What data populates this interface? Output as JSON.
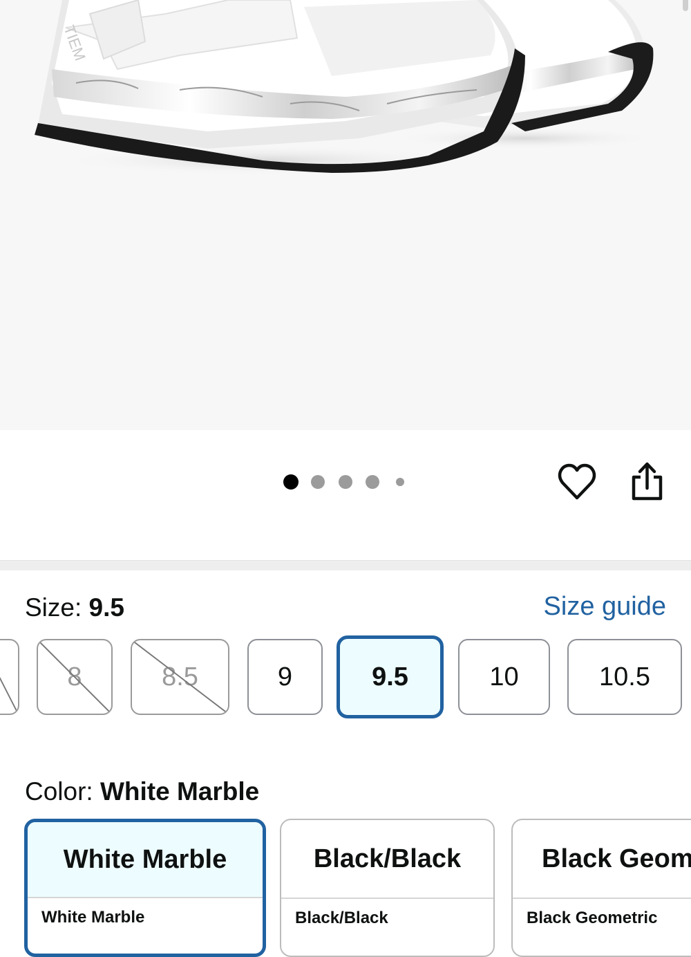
{
  "product_image": {
    "alt": "White marble cycling shoes",
    "brand_mark": "TIEM"
  },
  "carousel": {
    "total": 5,
    "active_index": 0
  },
  "actions": {
    "favorite_icon": "heart-icon",
    "share_icon": "share-icon"
  },
  "size": {
    "label": "Size:",
    "selected": "9.5",
    "guide_link": "Size guide",
    "options": [
      {
        "label": "",
        "available": false
      },
      {
        "label": "8",
        "available": false
      },
      {
        "label": "8.5",
        "available": false
      },
      {
        "label": "9",
        "available": true
      },
      {
        "label": "9.5",
        "available": true
      },
      {
        "label": "10",
        "available": true
      },
      {
        "label": "10.5",
        "available": true
      }
    ]
  },
  "color": {
    "label": "Color:",
    "selected": "White Marble",
    "options": [
      {
        "title": "White Marble",
        "subtitle": "White Marble"
      },
      {
        "title": "Black/Black",
        "subtitle": "Black/Black"
      },
      {
        "title": "Black Geom",
        "subtitle": "Black Geometric"
      }
    ]
  },
  "colors": {
    "accent": "#2162a1",
    "selected_bg": "#edfdff",
    "link": "#2162a1"
  }
}
